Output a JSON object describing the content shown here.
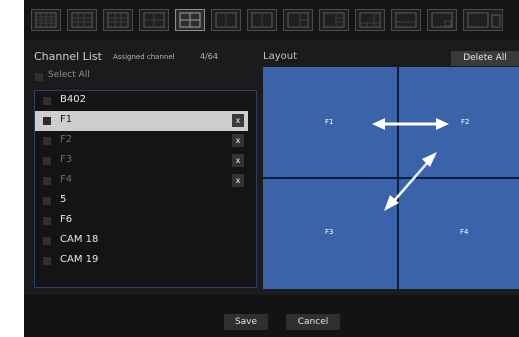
{
  "toolbar": {
    "buttons": [
      {
        "name": "grid-1x1-icon"
      },
      {
        "name": "grid-2x2-icon"
      },
      {
        "name": "grid-3x3-icon"
      },
      {
        "name": "grid-4x4-icon"
      },
      {
        "name": "grid-2x2-large-icon",
        "active": true
      },
      {
        "name": "grid-1x2-icon"
      },
      {
        "name": "grid-2x1-icon"
      },
      {
        "name": "grid-1plus3-icon"
      },
      {
        "name": "grid-1plus5-icon"
      },
      {
        "name": "grid-1plus7-icon"
      },
      {
        "name": "grid-1plus1-icon"
      },
      {
        "name": "grid-pip-icon"
      }
    ]
  },
  "channel_list": {
    "title": "Channel List",
    "assigned_label": "Assigned channel",
    "assigned_count": "4/64",
    "select_all": "Select All",
    "items": [
      {
        "label": "B402",
        "state": "normal"
      },
      {
        "label": "F1",
        "state": "selected",
        "remove": "x"
      },
      {
        "label": "F2",
        "state": "dim",
        "remove": "x"
      },
      {
        "label": "F3",
        "state": "dim",
        "remove": "x"
      },
      {
        "label": "F4",
        "state": "dim",
        "remove": "x"
      },
      {
        "label": "5",
        "state": "normal"
      },
      {
        "label": "F6",
        "state": "normal"
      },
      {
        "label": "CAM 18",
        "state": "normal"
      },
      {
        "label": "CAM 19",
        "state": "normal"
      }
    ]
  },
  "layout_panel": {
    "title": "Layout",
    "delete_all": "Delete All",
    "cells": [
      "F1",
      "F2",
      "F3",
      "F4"
    ]
  },
  "footer": {
    "save": "Save",
    "cancel": "Cancel"
  },
  "colors": {
    "layout_blue": "#3a63a9",
    "selection": "#cdcdcd",
    "panel": "#1b1b1b"
  }
}
